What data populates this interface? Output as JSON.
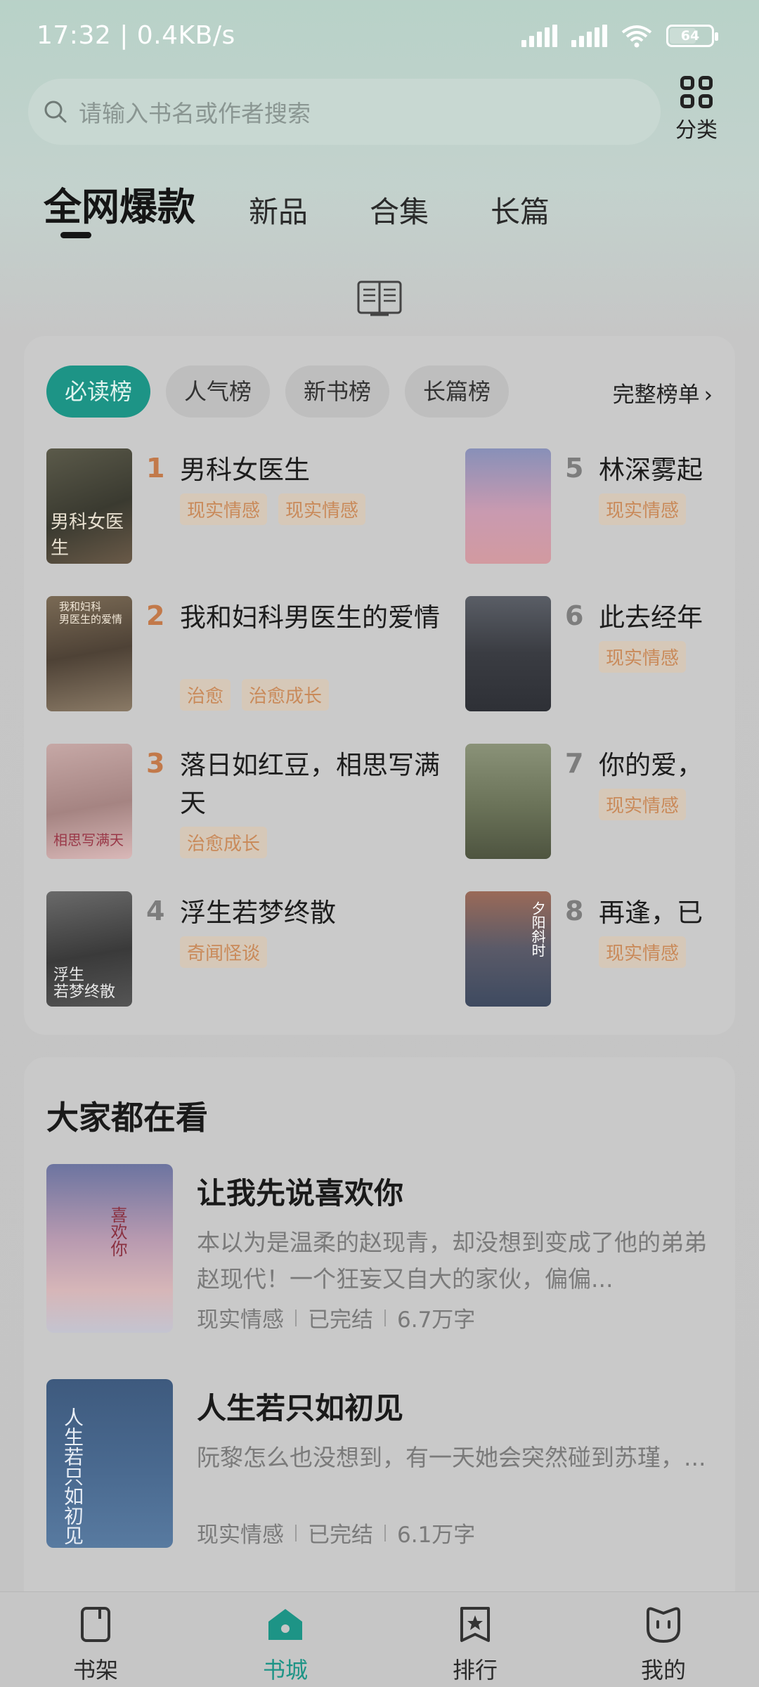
{
  "status_bar": {
    "time": "17:32 | 0.4KB/s",
    "battery": "64",
    "battery_level": 0.64,
    "icons": [
      "signal-icon",
      "signal-icon",
      "wifi-icon",
      "battery-icon"
    ]
  },
  "search": {
    "placeholder": "请输入书名或作者搜索",
    "category_label": "分类"
  },
  "tabs": [
    {
      "label": "全网爆款",
      "active": true
    },
    {
      "label": "新品",
      "active": false
    },
    {
      "label": "合集",
      "active": false
    },
    {
      "label": "长篇",
      "active": false
    }
  ],
  "ranking": {
    "pills": [
      {
        "label": "必读榜",
        "active": true
      },
      {
        "label": "人气榜",
        "active": false
      },
      {
        "label": "新书榜",
        "active": false
      },
      {
        "label": "长篇榜",
        "active": false
      }
    ],
    "full_link": "完整榜单",
    "items": [
      {
        "rank": "1",
        "title": "男科女医生",
        "tags": [
          "现实情感",
          "现实情感"
        ]
      },
      {
        "rank": "2",
        "title": "我和妇科男医生的爱情",
        "tags": [
          "治愈",
          "治愈成长"
        ]
      },
      {
        "rank": "3",
        "title": "落日如红豆，相思写满天",
        "tags": [
          "治愈成长"
        ]
      },
      {
        "rank": "4",
        "title": "浮生若梦终散",
        "tags": [
          "奇闻怪谈"
        ]
      },
      {
        "rank": "5",
        "title": "林深雾起",
        "tags": [
          "现实情感"
        ]
      },
      {
        "rank": "6",
        "title": "此去经年",
        "tags": [
          "现实情感"
        ]
      },
      {
        "rank": "7",
        "title": "你的爱，",
        "tags": [
          "现实情感"
        ]
      },
      {
        "rank": "8",
        "title": "再逢，已",
        "tags": [
          "现实情感"
        ]
      }
    ]
  },
  "reading": {
    "title": "大家都在看",
    "items": [
      {
        "title": "让我先说喜欢你",
        "desc": "本以为是温柔的赵现青，却没想到变成了他的弟弟赵现代！一个狂妄又自大的家伙，偏偏...",
        "genre": "现实情感",
        "status": "已完结",
        "words": "6.7万字"
      },
      {
        "title": "人生若只如初见",
        "desc": "阮黎怎么也没想到，有一天她会突然碰到苏瑾，...",
        "genre": "现实情感",
        "status": "已完结",
        "words": "6.1万字"
      }
    ]
  },
  "nav": [
    {
      "label": "书架",
      "icon": "bookshelf-icon",
      "active": false
    },
    {
      "label": "书城",
      "icon": "bookstore-icon",
      "active": true
    },
    {
      "label": "排行",
      "icon": "ranking-icon",
      "active": false
    },
    {
      "label": "我的",
      "icon": "profile-icon",
      "active": false
    }
  ],
  "colors": {
    "accent": "#1d9486",
    "rank_top": "#c2794a",
    "rank_other": "#7d7d7d",
    "tag_text": "#c98a5a"
  }
}
